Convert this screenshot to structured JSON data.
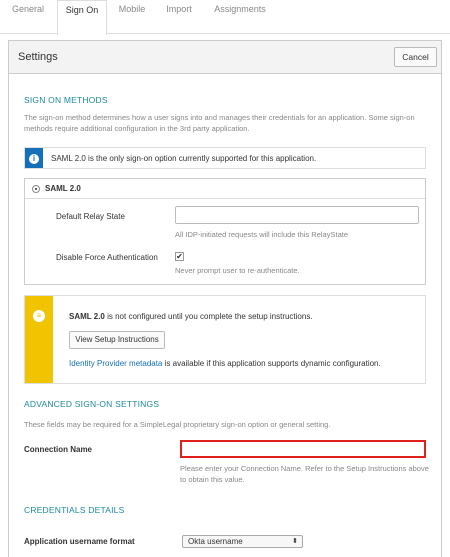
{
  "tabs": [
    {
      "label": "General"
    },
    {
      "label": "Sign On"
    },
    {
      "label": "Mobile"
    },
    {
      "label": "Import"
    },
    {
      "label": "Assignments"
    }
  ],
  "panel": {
    "title": "Settings",
    "cancel_label": "Cancel"
  },
  "sign_on": {
    "title": "SIGN ON METHODS",
    "description": "The sign-on method determines how a user signs into and manages their credentials for an application. Some sign-on methods require additional configuration in the 3rd party application.",
    "info_text": "SAML 2.0 is the only sign-on option currently supported for this application.",
    "saml_label": "SAML 2.0",
    "relay_state_label": "Default Relay State",
    "relay_state_value": "",
    "relay_state_help": "All IDP-initiated requests will include this RelayState",
    "force_auth_label": "Disable Force Authentication",
    "force_auth_checked": "✔",
    "force_auth_help": "Never prompt user to re-authenticate."
  },
  "setup_notice": {
    "bold": "SAML 2.0",
    "text": " is not configured until you complete the setup instructions.",
    "button_label": "View Setup Instructions",
    "link_text": "Identity Provider metadata",
    "link_suffix": " is available if this application supports dynamic configuration."
  },
  "advanced": {
    "title": "ADVANCED SIGN-ON SETTINGS",
    "description": "These fields may be required for a SimpleLegal proprietary sign-on option or general setting.",
    "connection_label": "Connection Name",
    "connection_value": "",
    "connection_help": "Please enter your Connection Name. Refer to the Setup Instructions above to obtain this value."
  },
  "credentials": {
    "title": "CREDENTIALS DETAILS",
    "username_format_label": "Application username format",
    "username_format_value": "Okta username"
  },
  "colors": {
    "accent_teal": "#1e8a9a",
    "info_blue": "#1570b8",
    "warn_yellow": "#f0c400",
    "error_red": "#e0201c"
  },
  "icons": {
    "info": "info-icon",
    "notice": "notice-icon",
    "checkmark": "checkmark-icon",
    "select_arrow": "chevron-updown-icon"
  }
}
